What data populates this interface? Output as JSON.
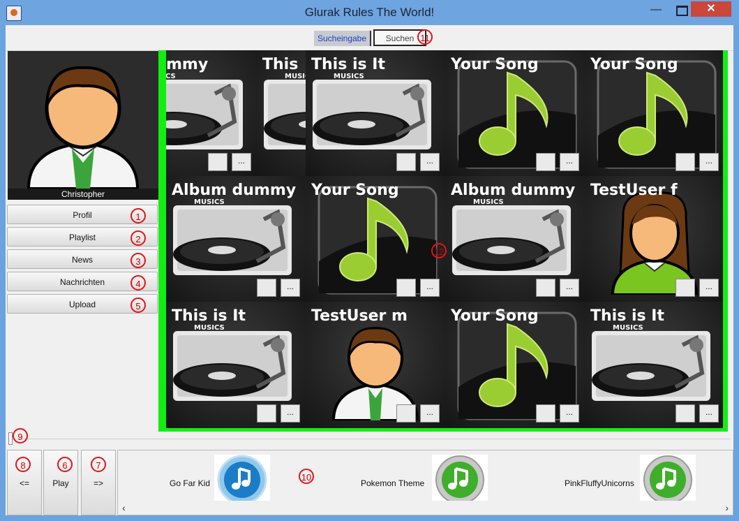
{
  "window": {
    "title": "Glurak Rules The World!",
    "close_glyph": "✕",
    "min_glyph": "—"
  },
  "search": {
    "label": "Sucheingabe",
    "button": "Suchen"
  },
  "profile": {
    "name": "Christopher"
  },
  "nav": {
    "items": [
      {
        "label": "Profil",
        "marker": "1"
      },
      {
        "label": "Playlist",
        "marker": "2"
      },
      {
        "label": "News",
        "marker": "3"
      },
      {
        "label": "Nachrichten",
        "marker": "4"
      },
      {
        "label": "Upload",
        "marker": "5"
      }
    ]
  },
  "grid": {
    "musics_label": "MUSICS",
    "more_label": "...",
    "tiles": [
      {
        "title": "m dummy",
        "kind": "vinyl"
      },
      {
        "title": "This",
        "kind": "vinyl"
      },
      {
        "title": "This is It",
        "kind": "vinyl"
      },
      {
        "title": "Your Song",
        "kind": "note"
      },
      {
        "title": "Your Song",
        "kind": "note"
      },
      {
        "title": "Album dummy",
        "kind": "vinyl"
      },
      {
        "title": "Your Song",
        "kind": "note"
      },
      {
        "title": "Album dummy",
        "kind": "vinyl"
      },
      {
        "title": "TestUser f",
        "kind": "person-female"
      },
      {
        "title": "This is It",
        "kind": "vinyl"
      },
      {
        "title": "TestUser m",
        "kind": "person-male"
      },
      {
        "title": "Your Song",
        "kind": "note"
      },
      {
        "title": "This is It",
        "kind": "vinyl"
      }
    ]
  },
  "player": {
    "prev_label": "<=",
    "play_label": "Play",
    "next_label": "=>"
  },
  "queue": {
    "items": [
      {
        "label": "Go Far Kid",
        "icon": "blue-note-icon"
      },
      {
        "label": "Pokemon Theme",
        "icon": "green-note-icon"
      },
      {
        "label": "PinkFluffyUnicorns",
        "icon": "green-note-icon"
      }
    ]
  },
  "markers": {
    "m6": "6",
    "m7": "7",
    "m8": "8",
    "m9": "9",
    "m10": "10",
    "m11": "11",
    "m12": "12"
  },
  "colors": {
    "accent_green": "#12ee12",
    "titlebar": "#6ea4e0",
    "marker_red": "#e0141a"
  }
}
